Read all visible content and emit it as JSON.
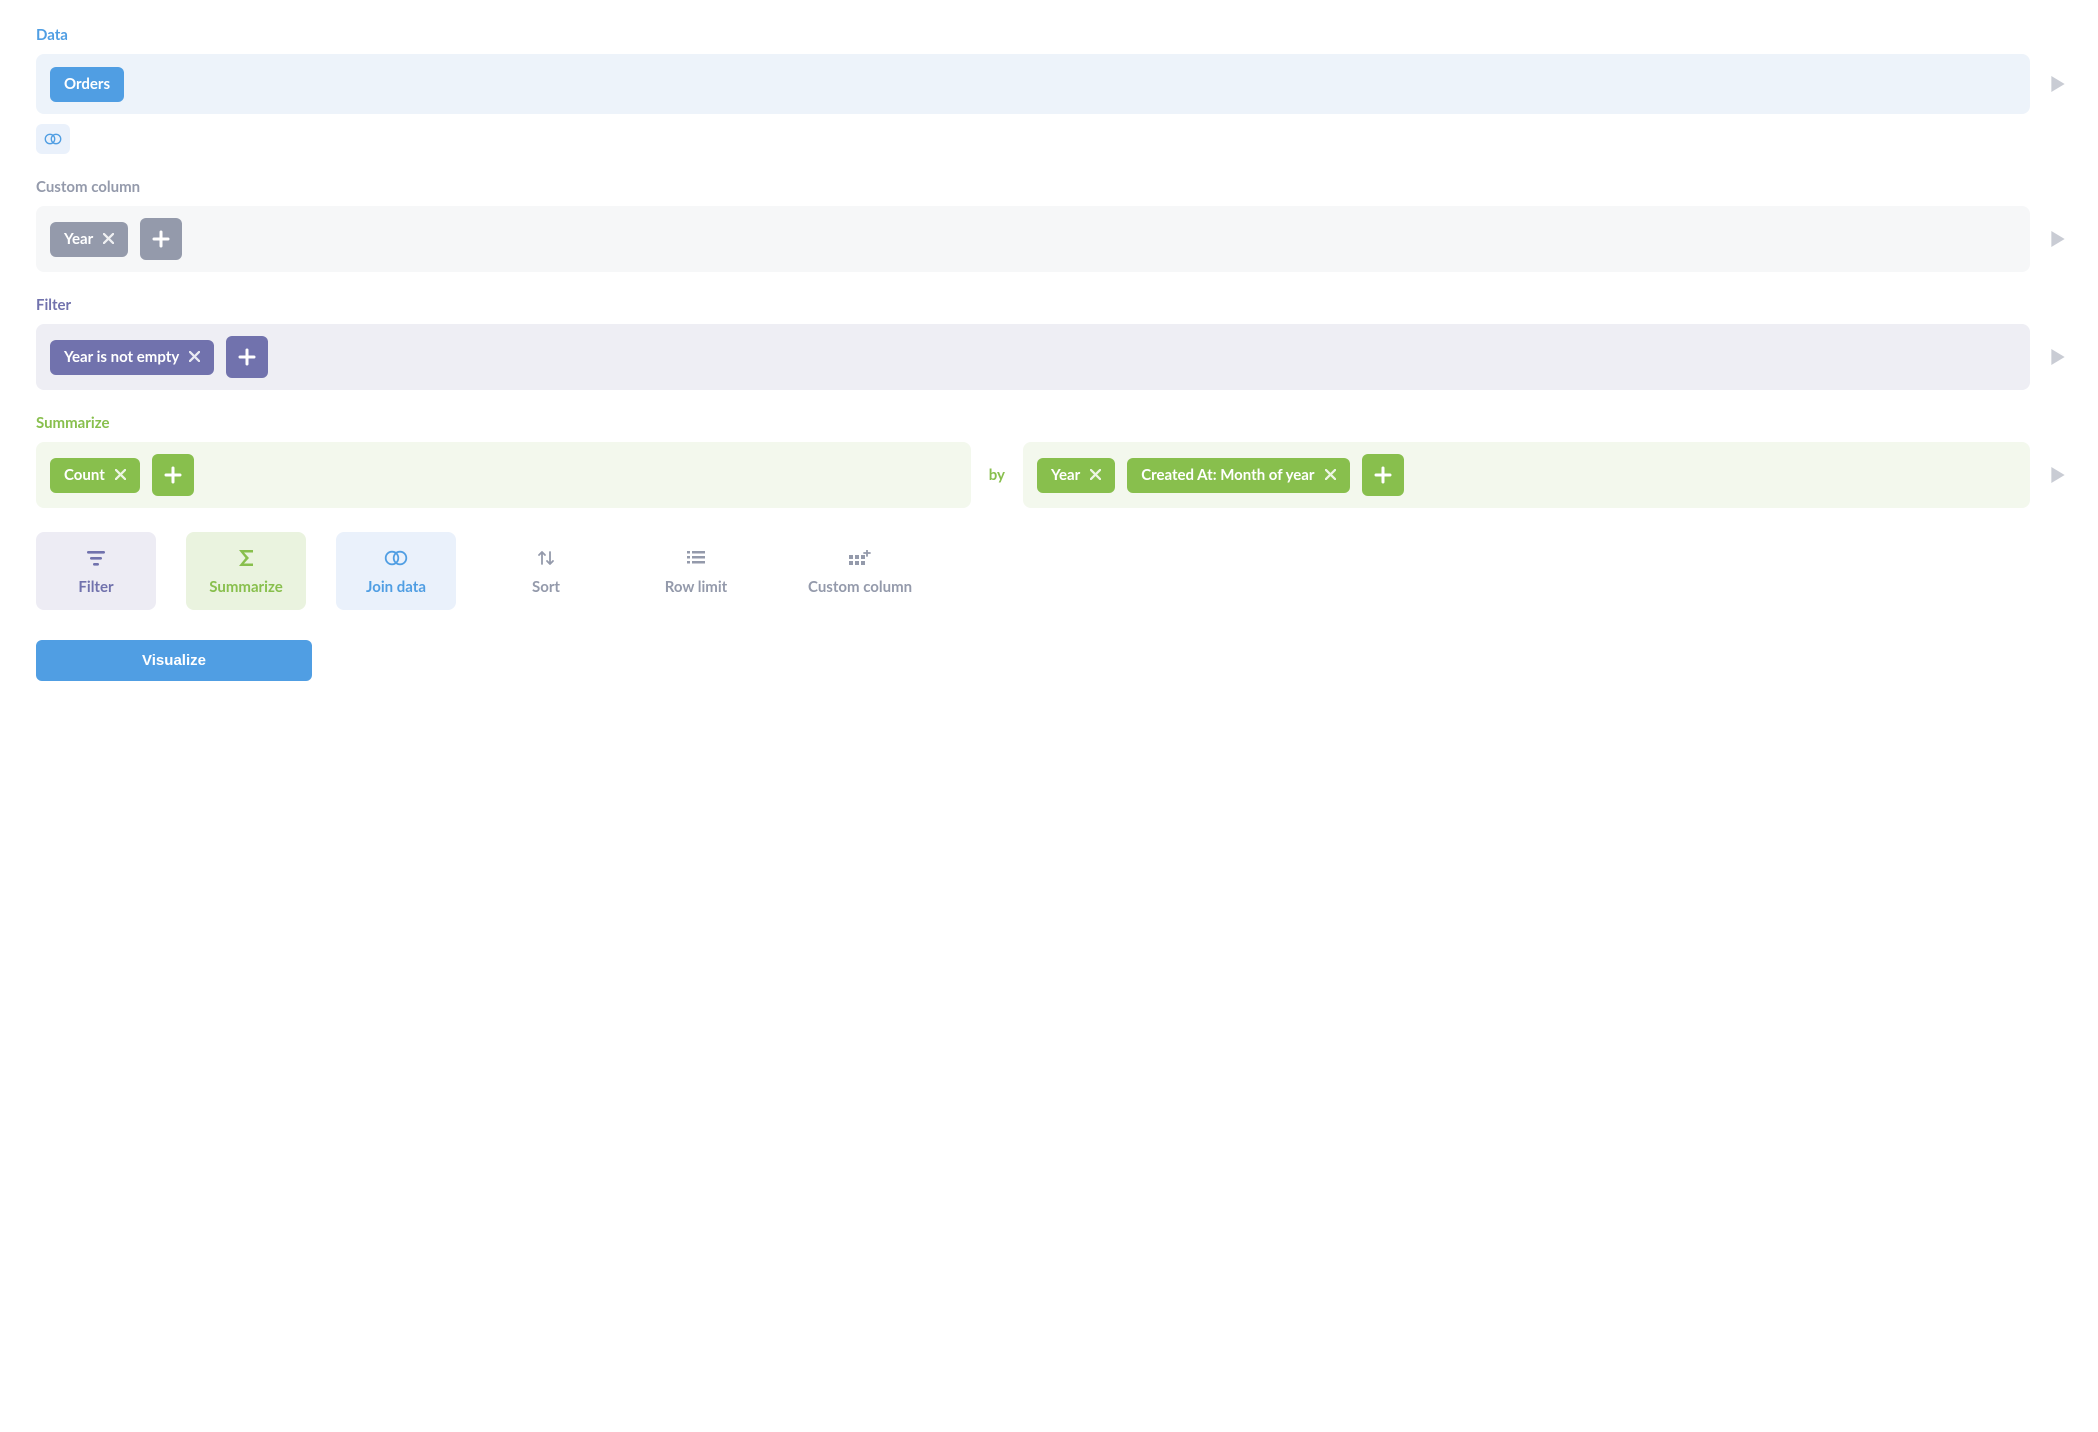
{
  "sections": {
    "data": {
      "label": "Data",
      "chips": [
        "Orders"
      ]
    },
    "custom_column": {
      "label": "Custom column",
      "chips": [
        "Year"
      ]
    },
    "filter": {
      "label": "Filter",
      "chips": [
        "Year is not empty"
      ]
    },
    "summarize": {
      "label": "Summarize",
      "aggregations": [
        "Count"
      ],
      "by_label": "by",
      "breakouts": [
        "Year",
        "Created At: Month of year"
      ]
    }
  },
  "action_tiles": {
    "filter": "Filter",
    "summarize": "Summarize",
    "join": "Join data",
    "sort": "Sort",
    "row_limit": "Row limit",
    "custom_column": "Custom column"
  },
  "visualize_label": "Visualize",
  "colors": {
    "blue": "#509ee3",
    "gray": "#949aab",
    "purple": "#7172ad",
    "green": "#88bf4d"
  }
}
